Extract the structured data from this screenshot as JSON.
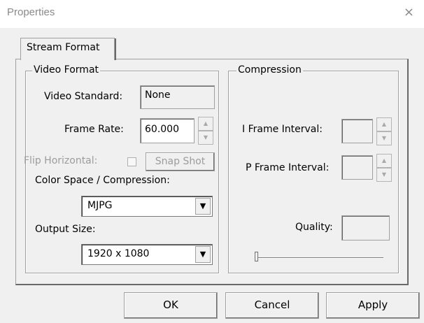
{
  "window": {
    "title": "Properties",
    "close_glyph": "×"
  },
  "tab": {
    "label": "Stream Format"
  },
  "video_format": {
    "legend": "Video Format",
    "video_standard_label": "Video Standard:",
    "video_standard_value": "None",
    "frame_rate_label": "Frame Rate:",
    "frame_rate_value": "60.000",
    "flip_horizontal_label": "Flip Horizontal:",
    "snap_shot_label": "Snap Shot",
    "color_space_label": "Color Space / Compression:",
    "color_space_value": "MJPG",
    "output_size_label": "Output Size:",
    "output_size_value": "1920 x 1080"
  },
  "compression": {
    "legend": "Compression",
    "i_frame_label": "I Frame Interval:",
    "i_frame_value": "",
    "p_frame_label": "P Frame Interval:",
    "p_frame_value": "",
    "quality_label": "Quality:",
    "quality_value": "",
    "quality_slider_fraction": 0
  },
  "buttons": {
    "ok": "OK",
    "cancel": "Cancel",
    "apply": "Apply"
  },
  "icons": {
    "spin_up": "▲",
    "spin_down": "▼",
    "dropdown": "▼"
  }
}
